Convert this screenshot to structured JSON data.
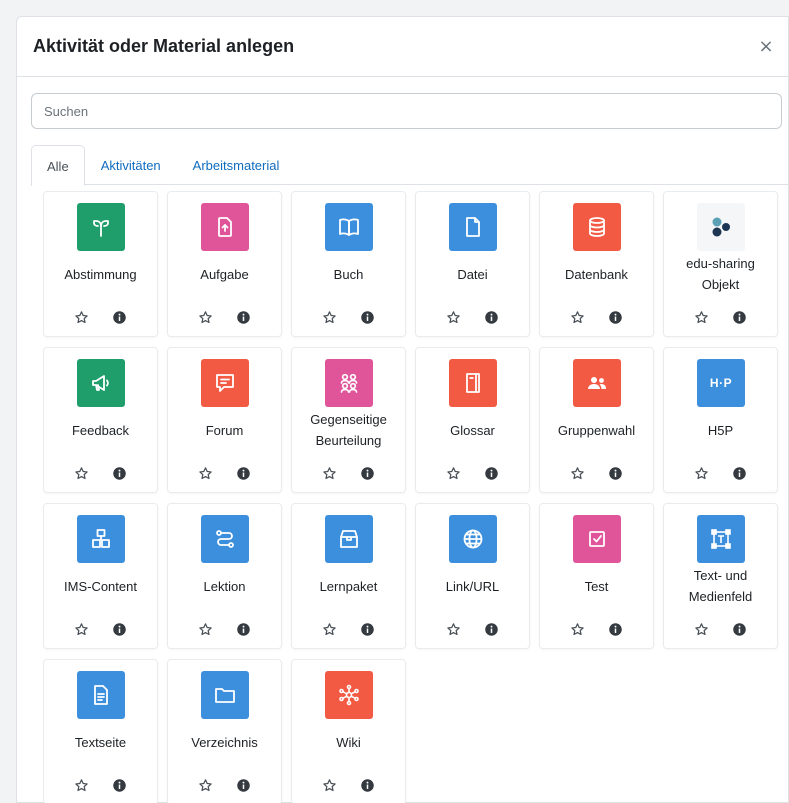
{
  "dialog": {
    "title": "Aktivität oder Material anlegen",
    "close_label": "×"
  },
  "search": {
    "placeholder": "Suchen",
    "value": ""
  },
  "tabs": [
    {
      "label": "Alle",
      "active": true
    },
    {
      "label": "Aktivitäten",
      "active": false
    },
    {
      "label": "Arbeitsmaterial",
      "active": false
    }
  ],
  "colors": {
    "green": "#1f9d6b",
    "pink": "#e0559a",
    "blue": "#3c8fdc",
    "red": "#f25a44",
    "link": "#0f6cbf"
  },
  "modules": [
    {
      "name": "Abstimmung",
      "icon": "choice-icon",
      "color": "#1f9d6b"
    },
    {
      "name": "Aufgabe",
      "icon": "assignment-icon",
      "color": "#e0559a"
    },
    {
      "name": "Buch",
      "icon": "book-icon",
      "color": "#3c8fdc"
    },
    {
      "name": "Datei",
      "icon": "file-icon",
      "color": "#3c8fdc"
    },
    {
      "name": "Datenbank",
      "icon": "database-icon",
      "color": "#f25a44"
    },
    {
      "name": "edu-sharing\nObjekt",
      "icon": "edu-sharing-icon",
      "color": "#f4f6f8"
    },
    {
      "name": "Feedback",
      "icon": "megaphone-icon",
      "color": "#1f9d6b"
    },
    {
      "name": "Forum",
      "icon": "forum-icon",
      "color": "#f25a44"
    },
    {
      "name": "Gegenseitige\nBeurteilung",
      "icon": "workshop-icon",
      "color": "#e0559a"
    },
    {
      "name": "Glossar",
      "icon": "glossary-icon",
      "color": "#f25a44"
    },
    {
      "name": "Gruppenwahl",
      "icon": "group-icon",
      "color": "#f25a44"
    },
    {
      "name": "H5P",
      "icon": "h5p-icon",
      "color": "#3c8fdc",
      "icon_text": "H·P"
    },
    {
      "name": "IMS-Content",
      "icon": "ims-icon",
      "color": "#3c8fdc"
    },
    {
      "name": "Lektion",
      "icon": "lesson-icon",
      "color": "#3c8fdc"
    },
    {
      "name": "Lernpaket",
      "icon": "scorm-icon",
      "color": "#3c8fdc"
    },
    {
      "name": "Link/URL",
      "icon": "globe-icon",
      "color": "#3c8fdc"
    },
    {
      "name": "Test",
      "icon": "quiz-icon",
      "color": "#e0559a"
    },
    {
      "name": "Text- und\nMedienfeld",
      "icon": "label-icon",
      "color": "#3c8fdc"
    },
    {
      "name": "Textseite",
      "icon": "page-icon",
      "color": "#3c8fdc"
    },
    {
      "name": "Verzeichnis",
      "icon": "folder-icon",
      "color": "#3c8fdc"
    },
    {
      "name": "Wiki",
      "icon": "wiki-icon",
      "color": "#f25a44"
    }
  ]
}
